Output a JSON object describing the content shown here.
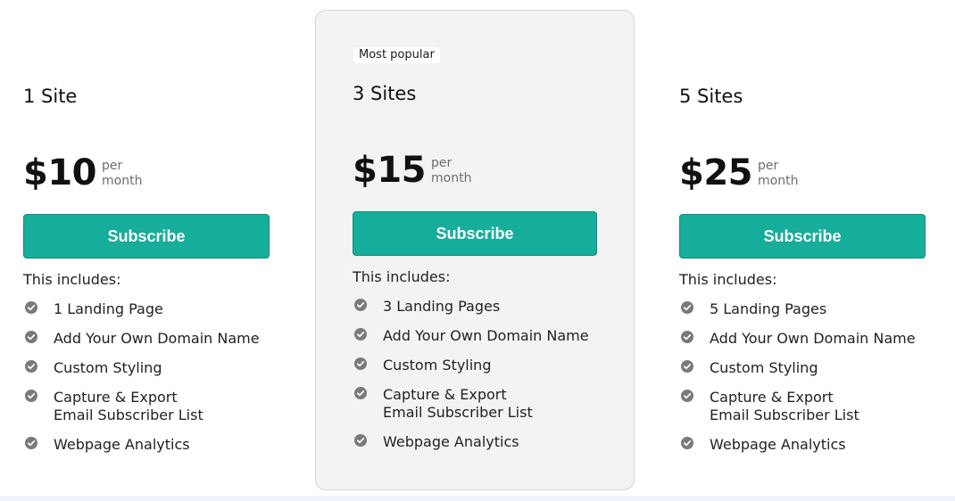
{
  "colors": {
    "accent": "#16ad9b",
    "accent_border": "#0d8f7f",
    "featured_bg": "#f3f3f3",
    "check_icon": "#7a7a7a"
  },
  "icons": {
    "feature_check": "check-circle-icon"
  },
  "plans": [
    {
      "name": "1 Site",
      "price": "$10",
      "period_line1": "per",
      "period_line2": "month",
      "button_label": "Subscribe",
      "includes_label": "This includes:",
      "features": [
        "1 Landing Page",
        "Add Your Own Domain Name",
        "Custom Styling",
        "Capture & Export Email Subscriber List",
        "Webpage Analytics"
      ]
    },
    {
      "badge": "Most popular",
      "name": "3 Sites",
      "price": "$15",
      "period_line1": "per",
      "period_line2": "month",
      "button_label": "Subscribe",
      "includes_label": "This includes:",
      "features": [
        "3 Landing Pages",
        "Add Your Own Domain Name",
        "Custom Styling",
        "Capture & Export Email Subscriber List",
        "Webpage Analytics"
      ]
    },
    {
      "name": "5 Sites",
      "price": "$25",
      "period_line1": "per",
      "period_line2": "month",
      "button_label": "Subscribe",
      "includes_label": "This includes:",
      "features": [
        "5 Landing Pages",
        "Add Your Own Domain Name",
        "Custom Styling",
        "Capture & Export Email Subscriber List",
        "Webpage Analytics"
      ]
    }
  ]
}
